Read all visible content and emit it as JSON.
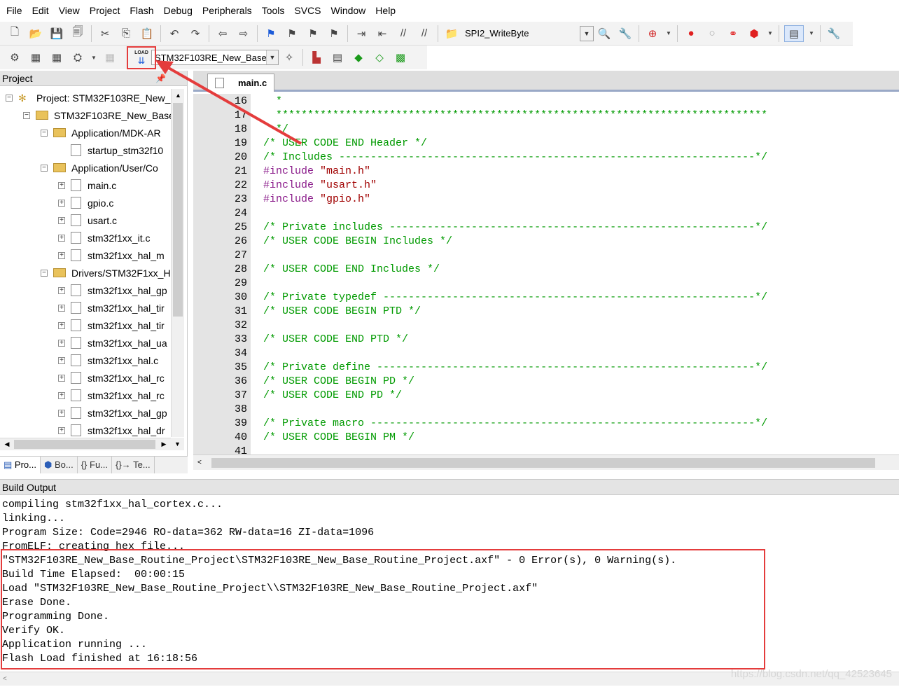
{
  "menu": [
    "File",
    "Edit",
    "View",
    "Project",
    "Flash",
    "Debug",
    "Peripherals",
    "Tools",
    "SVCS",
    "Window",
    "Help"
  ],
  "toolbar1": {
    "function_combo": "SPI2_WriteByte"
  },
  "toolbar2": {
    "load_button_text": "LOAD",
    "target_combo": "STM32F103RE_New_Base"
  },
  "project_panel": {
    "title": "Project",
    "pin_icon": "pin-icon",
    "tree": [
      {
        "label": "Project: STM32F103RE_New_",
        "kind": "project",
        "exp": "−"
      },
      {
        "label": "STM32F103RE_New_Base",
        "kind": "target",
        "exp": "−"
      },
      {
        "label": "Application/MDK-AR",
        "kind": "folder",
        "exp": "−"
      },
      {
        "label": "startup_stm32f10",
        "kind": "file",
        "exp": ""
      },
      {
        "label": "Application/User/Co",
        "kind": "folder",
        "exp": "−"
      },
      {
        "label": "main.c",
        "kind": "file",
        "exp": "+"
      },
      {
        "label": "gpio.c",
        "kind": "file",
        "exp": "+"
      },
      {
        "label": "usart.c",
        "kind": "file",
        "exp": "+"
      },
      {
        "label": "stm32f1xx_it.c",
        "kind": "file",
        "exp": "+"
      },
      {
        "label": "stm32f1xx_hal_m",
        "kind": "file",
        "exp": "+"
      },
      {
        "label": "Drivers/STM32F1xx_H",
        "kind": "folder",
        "exp": "−"
      },
      {
        "label": "stm32f1xx_hal_gp",
        "kind": "file",
        "exp": "+"
      },
      {
        "label": "stm32f1xx_hal_tir",
        "kind": "file",
        "exp": "+"
      },
      {
        "label": "stm32f1xx_hal_tir",
        "kind": "file",
        "exp": "+"
      },
      {
        "label": "stm32f1xx_hal_ua",
        "kind": "file",
        "exp": "+"
      },
      {
        "label": "stm32f1xx_hal.c",
        "kind": "file",
        "exp": "+"
      },
      {
        "label": "stm32f1xx_hal_rc",
        "kind": "file",
        "exp": "+"
      },
      {
        "label": "stm32f1xx_hal_rc",
        "kind": "file",
        "exp": "+"
      },
      {
        "label": "stm32f1xx_hal_gp",
        "kind": "file",
        "exp": "+"
      },
      {
        "label": "stm32f1xx_hal_dr",
        "kind": "file",
        "exp": "+"
      }
    ],
    "tabs": [
      "Pro...",
      "Bo...",
      "{} Fu...",
      "{}→ Te..."
    ]
  },
  "editor": {
    "tab_label": "main.c",
    "lines": [
      {
        "n": "16",
        "text": "  *",
        "type": "comment"
      },
      {
        "n": "17",
        "text": "  ******************************************************************************",
        "type": "comment"
      },
      {
        "n": "18",
        "text": "  */",
        "type": "comment"
      },
      {
        "n": "19",
        "text": "/* USER CODE END Header */",
        "type": "comment"
      },
      {
        "n": "20",
        "text": "/* Includes ------------------------------------------------------------------*/",
        "type": "comment"
      },
      {
        "n": "21",
        "text": "#include \"main.h\"",
        "type": "include"
      },
      {
        "n": "22",
        "text": "#include \"usart.h\"",
        "type": "include"
      },
      {
        "n": "23",
        "text": "#include \"gpio.h\"",
        "type": "include"
      },
      {
        "n": "24",
        "text": "",
        "type": "comment"
      },
      {
        "n": "25",
        "text": "/* Private includes ----------------------------------------------------------*/",
        "type": "comment"
      },
      {
        "n": "26",
        "text": "/* USER CODE BEGIN Includes */",
        "type": "comment"
      },
      {
        "n": "27",
        "text": "",
        "type": "comment"
      },
      {
        "n": "28",
        "text": "/* USER CODE END Includes */",
        "type": "comment"
      },
      {
        "n": "29",
        "text": "",
        "type": "comment"
      },
      {
        "n": "30",
        "text": "/* Private typedef -----------------------------------------------------------*/",
        "type": "comment"
      },
      {
        "n": "31",
        "text": "/* USER CODE BEGIN PTD */",
        "type": "comment"
      },
      {
        "n": "32",
        "text": "",
        "type": "comment"
      },
      {
        "n": "33",
        "text": "/* USER CODE END PTD */",
        "type": "comment"
      },
      {
        "n": "34",
        "text": "",
        "type": "comment"
      },
      {
        "n": "35",
        "text": "/* Private define ------------------------------------------------------------*/",
        "type": "comment"
      },
      {
        "n": "36",
        "text": "/* USER CODE BEGIN PD */",
        "type": "comment"
      },
      {
        "n": "37",
        "text": "/* USER CODE END PD */",
        "type": "comment"
      },
      {
        "n": "38",
        "text": "",
        "type": "comment"
      },
      {
        "n": "39",
        "text": "/* Private macro -------------------------------------------------------------*/",
        "type": "comment"
      },
      {
        "n": "40",
        "text": "/* USER CODE BEGIN PM */",
        "type": "comment"
      },
      {
        "n": "41",
        "text": "",
        "type": "comment"
      }
    ]
  },
  "build_output": {
    "title": "Build Output",
    "lines": [
      "compiling stm32f1xx_hal_cortex.c...",
      "linking...",
      "Program Size: Code=2946 RO-data=362 RW-data=16 ZI-data=1096",
      "FromELF: creating hex file...",
      "\"STM32F103RE_New_Base_Routine_Project\\STM32F103RE_New_Base_Routine_Project.axf\" - 0 Error(s), 0 Warning(s).",
      "Build Time Elapsed:  00:00:15",
      "Load \"STM32F103RE_New_Base_Routine_Project\\\\STM32F103RE_New_Base_Routine_Project.axf\"",
      "Erase Done.",
      "Programming Done.",
      "Verify OK.",
      "Application running ...",
      "Flash Load finished at 16:18:56"
    ],
    "watermark": "https://blog.csdn.net/qq_42523645"
  },
  "colors": {
    "highlight": "#e43c3c",
    "comment": "#009a00",
    "preprocessor": "#8b1c8b",
    "string": "#a00000"
  }
}
